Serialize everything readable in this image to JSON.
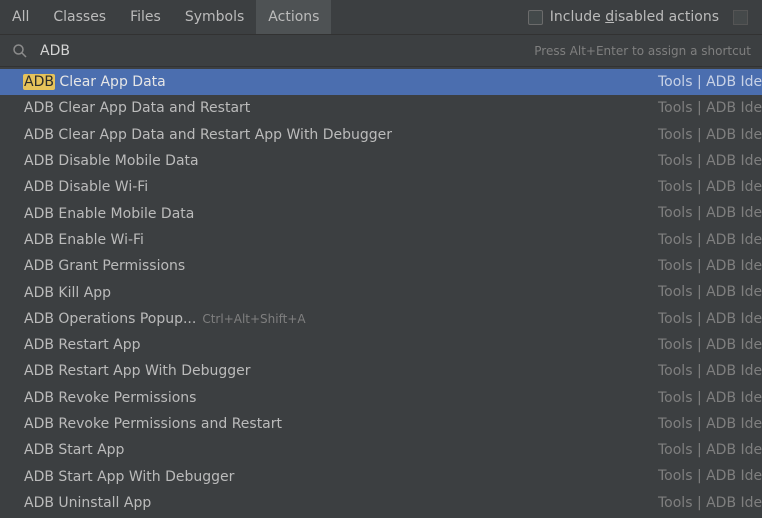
{
  "tabs": [
    "All",
    "Classes",
    "Files",
    "Symbols",
    "Actions"
  ],
  "active_tab": "Actions",
  "include_disabled": {
    "prefix": "Include ",
    "mnemonic": "d",
    "suffix": "isabled actions",
    "checked": false
  },
  "search": {
    "value": "ADB",
    "hint": "Press Alt+Enter to assign a shortcut"
  },
  "results": [
    {
      "match": "ADB",
      "rest": " Clear App Data",
      "shortcut": "",
      "group": "Tools | ADB Idea",
      "selected": true
    },
    {
      "match": "",
      "rest": "ADB Clear App Data and Restart",
      "shortcut": "",
      "group": "Tools | ADB Idea",
      "selected": false
    },
    {
      "match": "",
      "rest": "ADB Clear App Data and Restart App With Debugger",
      "shortcut": "",
      "group": "Tools | ADB Idea",
      "selected": false
    },
    {
      "match": "",
      "rest": "ADB Disable Mobile Data",
      "shortcut": "",
      "group": "Tools | ADB Idea",
      "selected": false
    },
    {
      "match": "",
      "rest": "ADB Disable Wi-Fi",
      "shortcut": "",
      "group": "Tools | ADB Idea",
      "selected": false
    },
    {
      "match": "",
      "rest": "ADB Enable Mobile Data",
      "shortcut": "",
      "group": "Tools | ADB Idea",
      "selected": false
    },
    {
      "match": "",
      "rest": "ADB Enable Wi-Fi",
      "shortcut": "",
      "group": "Tools | ADB Idea",
      "selected": false
    },
    {
      "match": "",
      "rest": "ADB Grant Permissions",
      "shortcut": "",
      "group": "Tools | ADB Idea",
      "selected": false
    },
    {
      "match": "",
      "rest": "ADB Kill App",
      "shortcut": "",
      "group": "Tools | ADB Idea",
      "selected": false
    },
    {
      "match": "",
      "rest": "ADB Operations Popup...",
      "shortcut": "Ctrl+Alt+Shift+A",
      "group": "Tools | ADB Idea",
      "selected": false
    },
    {
      "match": "",
      "rest": "ADB Restart App",
      "shortcut": "",
      "group": "Tools | ADB Idea",
      "selected": false
    },
    {
      "match": "",
      "rest": "ADB Restart App With Debugger",
      "shortcut": "",
      "group": "Tools | ADB Idea",
      "selected": false
    },
    {
      "match": "",
      "rest": "ADB Revoke Permissions",
      "shortcut": "",
      "group": "Tools | ADB Idea",
      "selected": false
    },
    {
      "match": "",
      "rest": "ADB Revoke Permissions and Restart",
      "shortcut": "",
      "group": "Tools | ADB Idea",
      "selected": false
    },
    {
      "match": "",
      "rest": "ADB Start App",
      "shortcut": "",
      "group": "Tools | ADB Idea",
      "selected": false
    },
    {
      "match": "",
      "rest": "ADB Start App With Debugger",
      "shortcut": "",
      "group": "Tools | ADB Idea",
      "selected": false
    },
    {
      "match": "",
      "rest": "ADB Uninstall App",
      "shortcut": "",
      "group": "Tools | ADB Idea",
      "selected": false
    }
  ],
  "colors": {
    "background": "#3c3f41",
    "selection": "#4b6eaf",
    "match_highlight": "#e6c35a",
    "secondary_text": "#7f7f7f"
  },
  "icons": {
    "search": "search-icon",
    "pin": "pin-icon",
    "checkbox": "checkbox-icon"
  }
}
